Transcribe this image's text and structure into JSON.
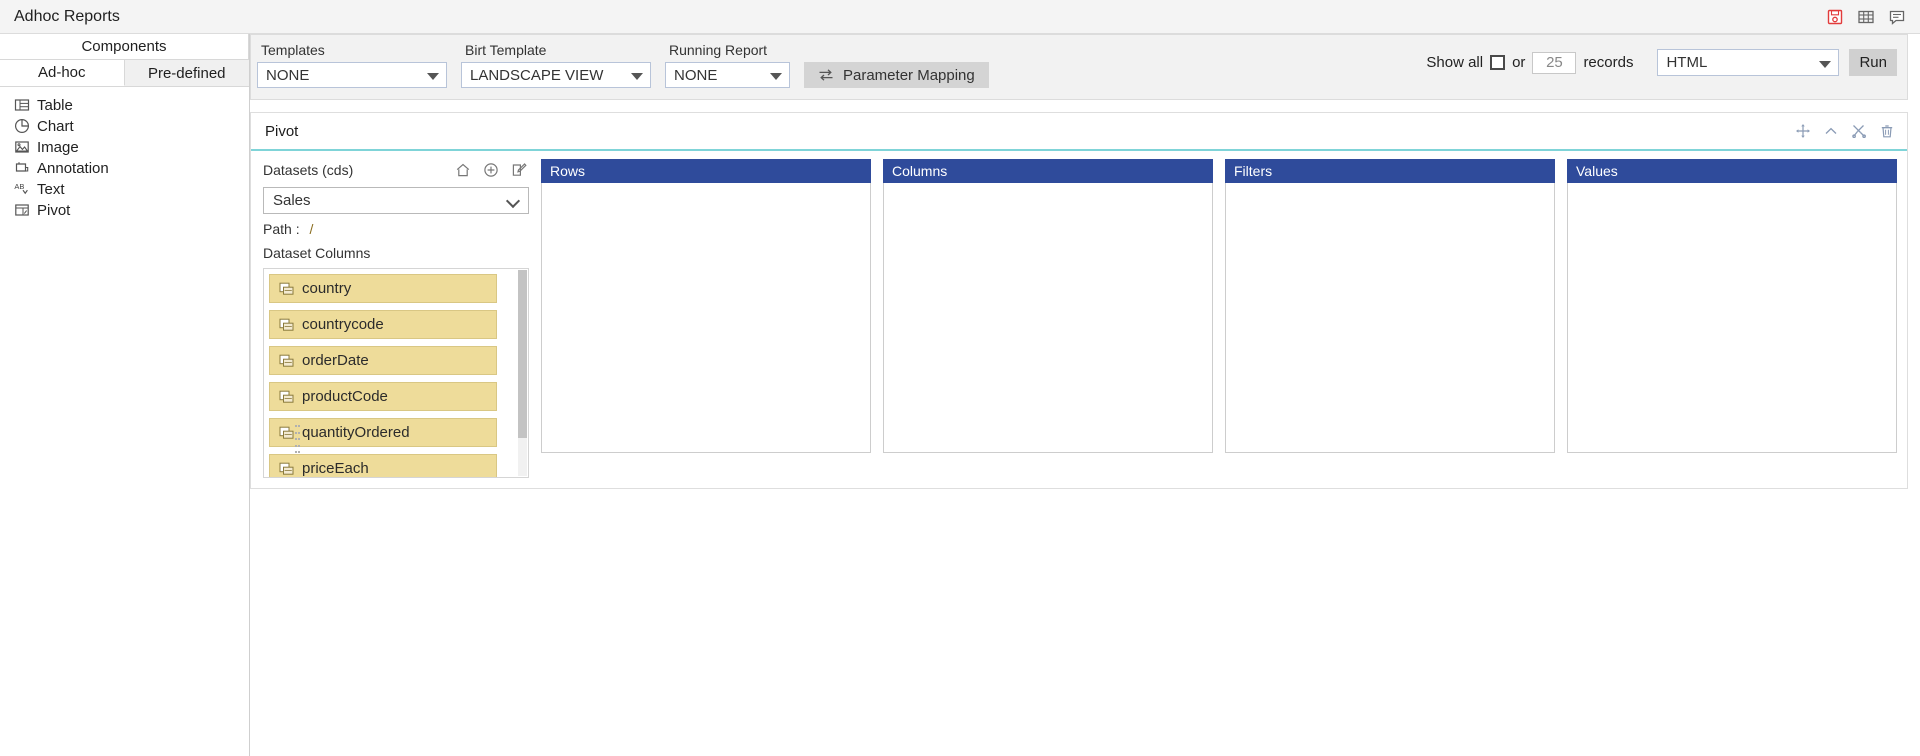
{
  "titlebar": {
    "title": "Adhoc Reports",
    "icons": [
      {
        "name": "save-report-icon",
        "label": "Save"
      },
      {
        "name": "grid-view-icon",
        "label": "Grid"
      },
      {
        "name": "comment-icon",
        "label": "Comment"
      }
    ]
  },
  "sidebar": {
    "header": "Components",
    "tabs": [
      {
        "label": "Ad-hoc",
        "active": true
      },
      {
        "label": "Pre-defined",
        "active": false
      }
    ],
    "items": [
      {
        "label": "Table",
        "icon": "table-icon"
      },
      {
        "label": "Chart",
        "icon": "pie-chart-icon"
      },
      {
        "label": "Image",
        "icon": "image-icon"
      },
      {
        "label": "Annotation",
        "icon": "annotation-icon"
      },
      {
        "label": "Text",
        "icon": "text-icon"
      },
      {
        "label": "Pivot",
        "icon": "pivot-icon"
      }
    ]
  },
  "toolbar": {
    "templates_label": "Templates",
    "templates_value": "NONE",
    "birt_label": "Birt Template",
    "birt_value": "LANDSCAPE VIEW",
    "running_label": "Running Report",
    "running_value": "NONE",
    "parameter_mapping_label": "Parameter Mapping",
    "show_all_label": "Show all",
    "or_label": "or",
    "records_value": "25",
    "records_label": "records",
    "format_value": "HTML",
    "run_label": "Run"
  },
  "widget": {
    "title": "Pivot",
    "tools": [
      {
        "name": "move-icon"
      },
      {
        "name": "collapse-chevron-icon"
      },
      {
        "name": "tools-icon"
      },
      {
        "name": "delete-icon"
      }
    ],
    "datasets": {
      "heading": "Datasets (cds)",
      "actions": [
        {
          "name": "home-icon"
        },
        {
          "name": "add-circle-icon"
        },
        {
          "name": "edit-icon"
        }
      ],
      "selected": "Sales",
      "path_label": "Path :",
      "path_value": "/",
      "columns_label": "Dataset Columns",
      "columns": [
        "country",
        "countrycode",
        "orderDate",
        "productCode",
        "quantityOrdered",
        "priceEach"
      ]
    },
    "zones": [
      {
        "label": "Rows",
        "items": []
      },
      {
        "label": "Columns",
        "items": []
      },
      {
        "label": "Filters",
        "items": []
      },
      {
        "label": "Values",
        "items": []
      }
    ]
  },
  "colors": {
    "zone_header": "#2f4b9b",
    "chip_bg": "#eedc9a",
    "widget_accent": "#7fd4d8",
    "save_icon": "#e23b3b"
  }
}
